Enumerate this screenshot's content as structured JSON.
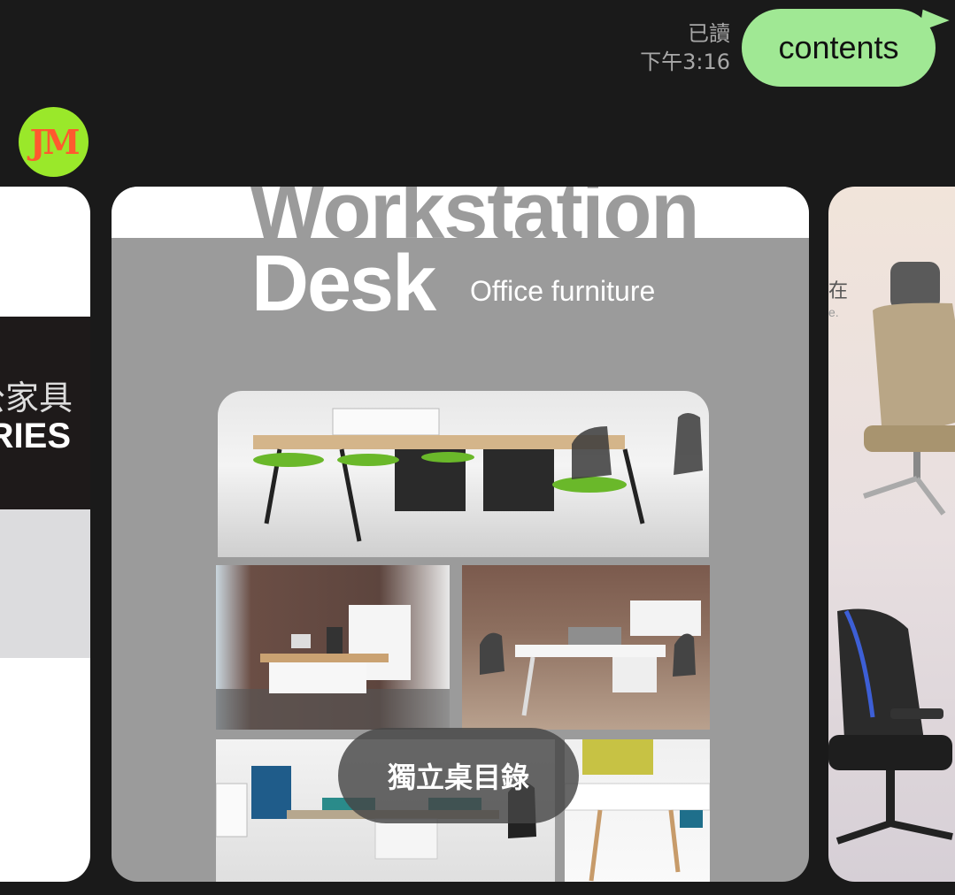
{
  "outgoing_message": {
    "read_status": "已讀",
    "time": "下午3:16",
    "text": "contents"
  },
  "sender": {
    "avatar_initials": "JM"
  },
  "carousel": {
    "left_card": {
      "text_cn": "公家具",
      "text_en": "RIES"
    },
    "main_card": {
      "title_line1": "Workstation",
      "title_line2": "Desk",
      "subtitle": "Office furniture",
      "button_label": "獨立桌目錄"
    },
    "right_card": {
      "text_cn": "在",
      "text_en": "e."
    }
  },
  "colors": {
    "background": "#1a1a1a",
    "bubble_green": "#a0e894",
    "avatar_bg": "#9ae82a",
    "avatar_text": "#ff5a2e",
    "card_gray": "#9b9b9b"
  }
}
